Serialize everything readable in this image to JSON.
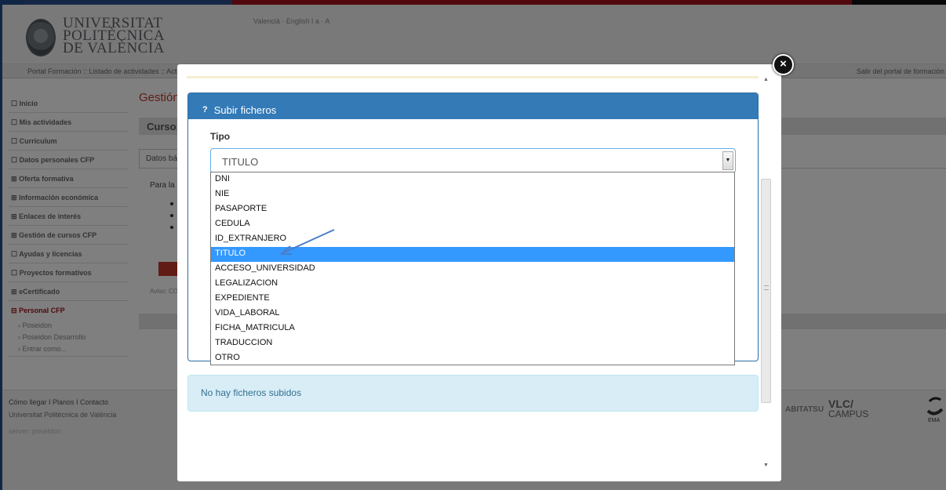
{
  "header": {
    "university_lines": [
      "UNIVERSITAT",
      "POLITÈCNICA",
      "DE VALÈNCIA"
    ],
    "lang_links": "Valencià · English  I  a · A"
  },
  "breadcrumb": {
    "path": "Portal Formación  ::  Listado de actividades  ::  Acti",
    "logout": "Salir del portal de formación"
  },
  "sidebar": {
    "items": [
      {
        "icon": "☐",
        "label": "Inicio"
      },
      {
        "icon": "☐",
        "label": "Mis actividades"
      },
      {
        "icon": "☐",
        "label": "Curriculum"
      },
      {
        "icon": "☐",
        "label": "Datos personales CFP"
      },
      {
        "icon": "⊞",
        "label": "Oferta formativa"
      },
      {
        "icon": "⊞",
        "label": "Información económica"
      },
      {
        "icon": "⊞",
        "label": "Enlaces de interés"
      },
      {
        "icon": "⊞",
        "label": "Gestión de cursos CFP"
      },
      {
        "icon": "☐",
        "label": "Ayudas y licencias"
      },
      {
        "icon": "☐",
        "label": "Proyectos formativos"
      },
      {
        "icon": "⊞",
        "label": "eCertificado"
      },
      {
        "icon": "⊟",
        "label": "Personal CFP"
      }
    ],
    "subitems": [
      "› Poseidon",
      "› Poseidon Desarrollo",
      "› Entrar como..."
    ]
  },
  "main": {
    "title": "Gestión",
    "course_label": "Curso:",
    "tab_datos": "Datos bás",
    "para_text": "Para la",
    "aviso": "Aviso: CO"
  },
  "footer": {
    "links": "Cómo llegar  I  Planos  I  Contacto",
    "university": "Universitat Politècnica de València",
    "server": "server: poseidon",
    "habitat": "ABITATSU",
    "vlc_top": "VLC/",
    "vlc_bottom": "CAMPUS",
    "ema": "EMA"
  },
  "modal": {
    "close_symbol": "×",
    "panel_help": "?",
    "panel_title": "Subir ficheros",
    "tipo_label": "Tipo",
    "select_value": "TITULO",
    "options": [
      "DNI",
      "NIE",
      "PASAPORTE",
      "CEDULA",
      "ID_EXTRANJERO",
      "TITULO",
      "ACCESO_UNIVERSIDAD",
      "LEGALIZACION",
      "EXPEDIENTE",
      "VIDA_LABORAL",
      "FICHA_MATRICULA",
      "TRADUCCION",
      "OTRO"
    ],
    "selected_index": 5,
    "no_files": "No hay ficheros subidos"
  },
  "colors": {
    "panel_header": "#337ab7",
    "selected_option": "#3399ff",
    "brand_red": "#a3131b",
    "info_bg": "#d9edf7",
    "annotation_arrow": "#4a7ec9"
  }
}
